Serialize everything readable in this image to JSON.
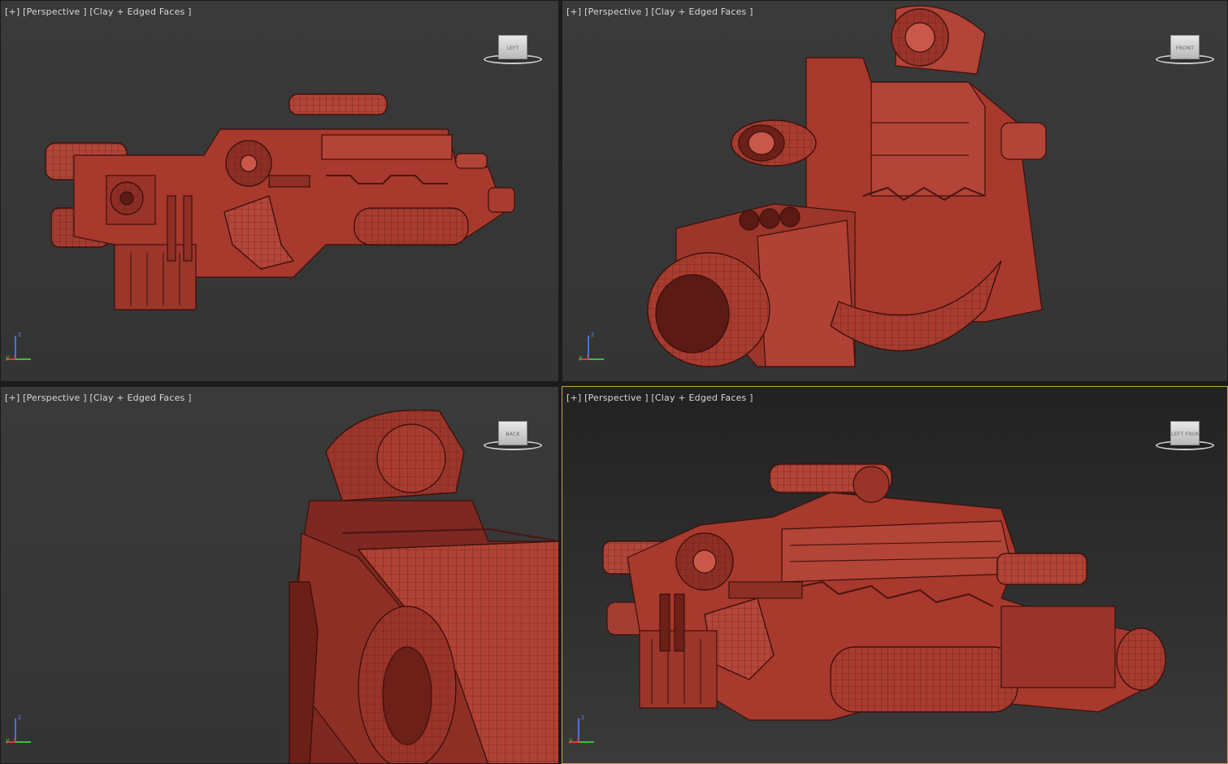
{
  "viewports": [
    {
      "label_plus": "[+]",
      "label_view": "[Perspective ]",
      "label_shading": "[Clay + Edged Faces ]",
      "cube_face": "LEFT",
      "active": false
    },
    {
      "label_plus": "[+]",
      "label_view": "[Perspective ]",
      "label_shading": "[Clay + Edged Faces ]",
      "cube_face": "FRONT",
      "active": false
    },
    {
      "label_plus": "[+]",
      "label_view": "[Perspective ]",
      "label_shading": "[Clay + Edged Faces ]",
      "cube_face": "BACK",
      "active": false
    },
    {
      "label_plus": "[+]",
      "label_view": "[Perspective ]",
      "label_shading": "[Clay + Edged Faces ]",
      "cube_face": "LEFT FRONT",
      "active": true
    }
  ],
  "axis": {
    "z": "z",
    "y": "y",
    "x": "x"
  },
  "colors": {
    "model": "#a8392d",
    "model_dark": "#6d2018",
    "model_light": "#c9574a",
    "wire": "#4a1510",
    "viewport_bg": "#3b3b3b",
    "active_border": "#c9a54a"
  }
}
